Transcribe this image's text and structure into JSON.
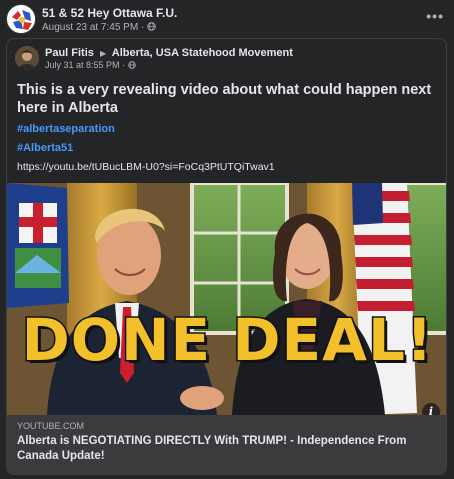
{
  "outer_post": {
    "page_name": "51 & 52 Hey Ottawa F.U.",
    "timestamp": "August 23 at 7:45 PM",
    "dot": "·",
    "more_label": "•••"
  },
  "shared_post": {
    "author": "Paul Fitis",
    "arrow": "▶",
    "group": "Alberta, USA Statehood Movement",
    "timestamp": "July 31 at 8:55 PM",
    "dot": "·",
    "text": "This is a very revealing video about what could happen next here in Alberta",
    "hashtags": [
      "#albertaseparation",
      "#Alberta51"
    ],
    "url": "https://youtu.be/tUBucLBM-U0?si=FoCq3PtUTQiTwav1"
  },
  "thumbnail": {
    "overlay_text": "DONE DEAL!",
    "info_label": "i"
  },
  "link_card": {
    "domain": "YOUTUBE.COM",
    "title": "Alberta is NEGOTIATING DIRECTLY With TRUMP! - Independence From Canada Update!"
  },
  "colors": {
    "background": "#242526",
    "hashtag": "#4599ff",
    "overlay_fill": "#f2c02a",
    "overlay_stroke": "#111111"
  },
  "icons": {
    "privacy": "globe-icon",
    "more": "ellipsis-icon",
    "info": "info-icon"
  }
}
